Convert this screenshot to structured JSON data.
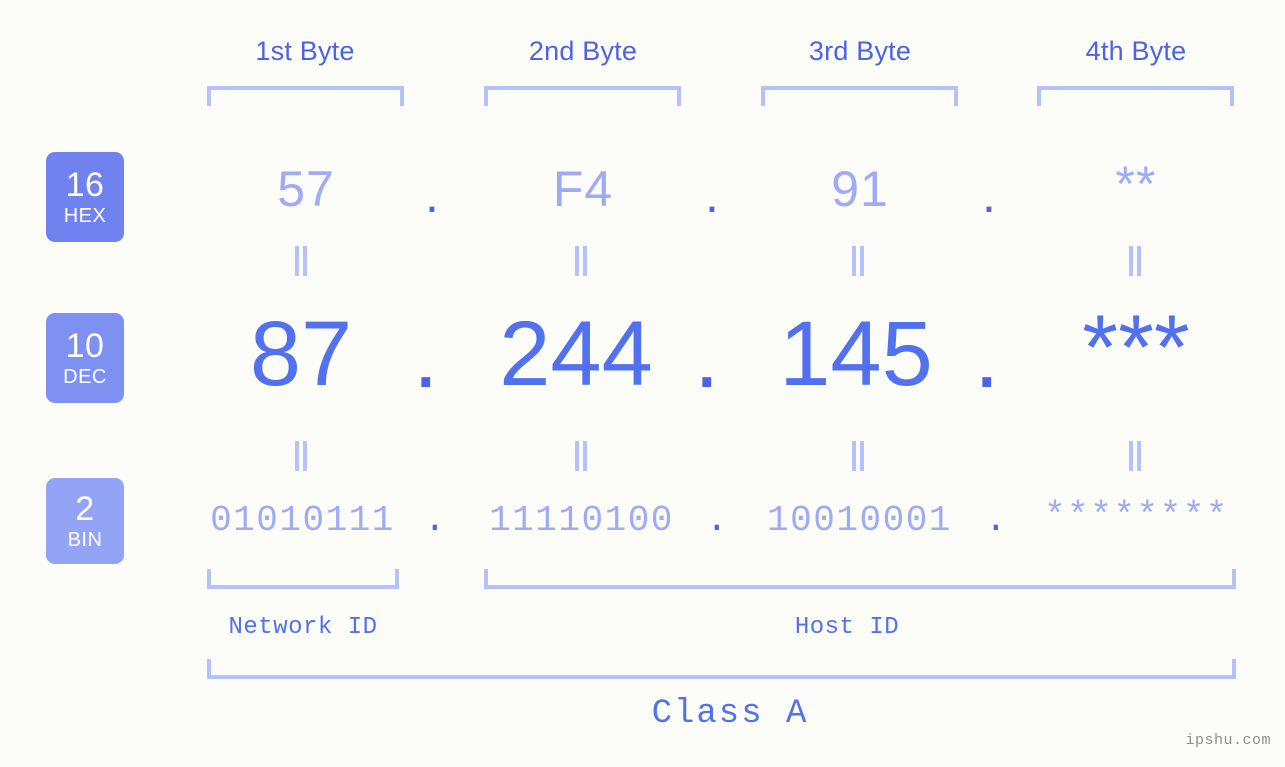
{
  "background_color": "#fcfdf9",
  "accent_color": "#5271ee",
  "muted_color": "#9facf4",
  "bracket_color": "#b6c0fb",
  "byte_headers": [
    {
      "label": "1st Byte"
    },
    {
      "label": "2nd Byte"
    },
    {
      "label": "3rd Byte"
    },
    {
      "label": "4th Byte"
    }
  ],
  "bases": [
    {
      "num": "16",
      "abbr": "HEX",
      "color": "#6f82ef"
    },
    {
      "num": "10",
      "abbr": "DEC",
      "color": "#7e90f2"
    },
    {
      "num": "2",
      "abbr": "BIN",
      "color": "#93a4f6"
    }
  ],
  "rows": {
    "hex": {
      "base_label": "HEX",
      "values": [
        "57",
        "F4",
        "91",
        "**"
      ],
      "separator": "."
    },
    "dec": {
      "base_label": "DEC",
      "values": [
        "87",
        "244",
        "145",
        "***"
      ],
      "separator": "."
    },
    "bin": {
      "base_label": "BIN",
      "values": [
        "01010111",
        "11110100",
        "10010001",
        "********"
      ],
      "separator": "."
    }
  },
  "equals_symbol": "=",
  "segments": {
    "network_id": "Network ID",
    "host_id": "Host ID",
    "class_name": "Class A"
  },
  "watermark": "ipshu.com"
}
